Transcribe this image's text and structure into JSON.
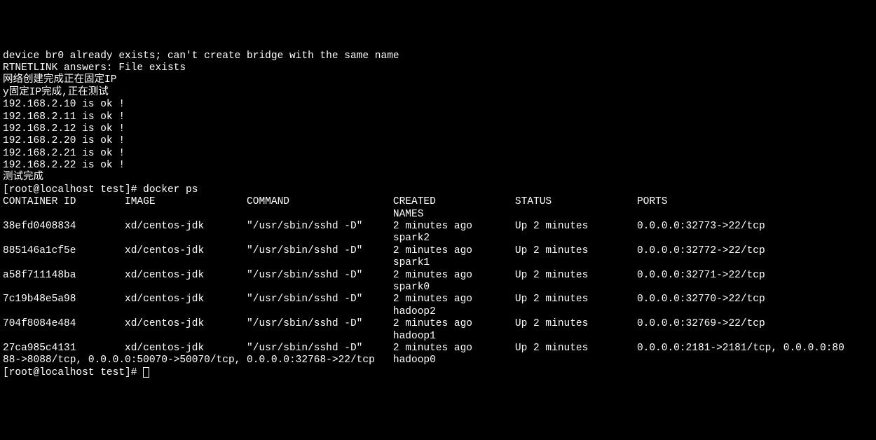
{
  "lines": [
    "device br0 already exists; can't create bridge with the same name",
    "RTNETLINK answers: File exists",
    "网络创建完成正在固定IP",
    "y固定IP完成,正在测试",
    "192.168.2.10 is ok !",
    "192.168.2.11 is ok !",
    "192.168.2.12 is ok !",
    "192.168.2.20 is ok !",
    "192.168.2.21 is ok !",
    "192.168.2.22 is ok !",
    "测试完成"
  ],
  "prompt1": "[root@localhost test]# ",
  "command1": "docker ps",
  "headers": {
    "container_id": "CONTAINER ID",
    "image": "IMAGE",
    "command": "COMMAND",
    "created": "CREATED",
    "status": "STATUS",
    "ports": "PORTS",
    "names": "NAMES"
  },
  "containers": [
    {
      "id": "38efd0408834",
      "image": "xd/centos-jdk",
      "command": "\"/usr/sbin/sshd -D\"",
      "created": "2 minutes ago",
      "status": "Up 2 minutes",
      "ports": "0.0.0.0:32773->22/tcp",
      "name": "spark2"
    },
    {
      "id": "885146a1cf5e",
      "image": "xd/centos-jdk",
      "command": "\"/usr/sbin/sshd -D\"",
      "created": "2 minutes ago",
      "status": "Up 2 minutes",
      "ports": "0.0.0.0:32772->22/tcp",
      "name": "spark1"
    },
    {
      "id": "a58f711148ba",
      "image": "xd/centos-jdk",
      "command": "\"/usr/sbin/sshd -D\"",
      "created": "2 minutes ago",
      "status": "Up 2 minutes",
      "ports": "0.0.0.0:32771->22/tcp",
      "name": "spark0"
    },
    {
      "id": "7c19b48e5a98",
      "image": "xd/centos-jdk",
      "command": "\"/usr/sbin/sshd -D\"",
      "created": "2 minutes ago",
      "status": "Up 2 minutes",
      "ports": "0.0.0.0:32770->22/tcp",
      "name": "hadoop2"
    },
    {
      "id": "704f8084e484",
      "image": "xd/centos-jdk",
      "command": "\"/usr/sbin/sshd -D\"",
      "created": "2 minutes ago",
      "status": "Up 2 minutes",
      "ports": "0.0.0.0:32769->22/tcp",
      "name": "hadoop1"
    }
  ],
  "last_container": {
    "id": "27ca985c4131",
    "image": "xd/centos-jdk",
    "command": "\"/usr/sbin/sshd -D\"",
    "created": "2 minutes ago",
    "status": "Up 2 minutes",
    "ports_line1": "0.0.0.0:2181->2181/tcp, 0.0.0.0:80",
    "ports_line2": "88->8088/tcp, 0.0.0.0:50070->50070/tcp, 0.0.0.0:32768->22/tcp",
    "name": "hadoop0"
  },
  "prompt2": "[root@localhost test]# "
}
